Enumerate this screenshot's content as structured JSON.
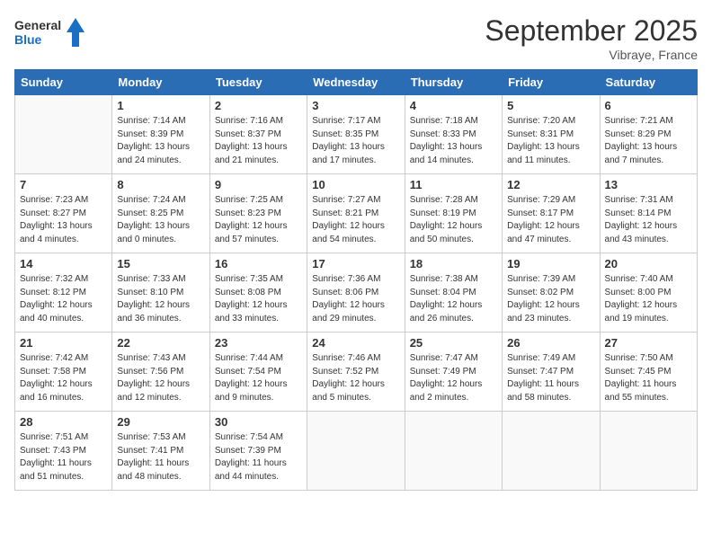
{
  "logo": {
    "general": "General",
    "blue": "Blue"
  },
  "title": "September 2025",
  "location": "Vibraye, France",
  "days_of_week": [
    "Sunday",
    "Monday",
    "Tuesday",
    "Wednesday",
    "Thursday",
    "Friday",
    "Saturday"
  ],
  "weeks": [
    [
      {
        "day": "",
        "info": ""
      },
      {
        "day": "1",
        "info": "Sunrise: 7:14 AM\nSunset: 8:39 PM\nDaylight: 13 hours\nand 24 minutes."
      },
      {
        "day": "2",
        "info": "Sunrise: 7:16 AM\nSunset: 8:37 PM\nDaylight: 13 hours\nand 21 minutes."
      },
      {
        "day": "3",
        "info": "Sunrise: 7:17 AM\nSunset: 8:35 PM\nDaylight: 13 hours\nand 17 minutes."
      },
      {
        "day": "4",
        "info": "Sunrise: 7:18 AM\nSunset: 8:33 PM\nDaylight: 13 hours\nand 14 minutes."
      },
      {
        "day": "5",
        "info": "Sunrise: 7:20 AM\nSunset: 8:31 PM\nDaylight: 13 hours\nand 11 minutes."
      },
      {
        "day": "6",
        "info": "Sunrise: 7:21 AM\nSunset: 8:29 PM\nDaylight: 13 hours\nand 7 minutes."
      }
    ],
    [
      {
        "day": "7",
        "info": "Sunrise: 7:23 AM\nSunset: 8:27 PM\nDaylight: 13 hours\nand 4 minutes."
      },
      {
        "day": "8",
        "info": "Sunrise: 7:24 AM\nSunset: 8:25 PM\nDaylight: 13 hours\nand 0 minutes."
      },
      {
        "day": "9",
        "info": "Sunrise: 7:25 AM\nSunset: 8:23 PM\nDaylight: 12 hours\nand 57 minutes."
      },
      {
        "day": "10",
        "info": "Sunrise: 7:27 AM\nSunset: 8:21 PM\nDaylight: 12 hours\nand 54 minutes."
      },
      {
        "day": "11",
        "info": "Sunrise: 7:28 AM\nSunset: 8:19 PM\nDaylight: 12 hours\nand 50 minutes."
      },
      {
        "day": "12",
        "info": "Sunrise: 7:29 AM\nSunset: 8:17 PM\nDaylight: 12 hours\nand 47 minutes."
      },
      {
        "day": "13",
        "info": "Sunrise: 7:31 AM\nSunset: 8:14 PM\nDaylight: 12 hours\nand 43 minutes."
      }
    ],
    [
      {
        "day": "14",
        "info": "Sunrise: 7:32 AM\nSunset: 8:12 PM\nDaylight: 12 hours\nand 40 minutes."
      },
      {
        "day": "15",
        "info": "Sunrise: 7:33 AM\nSunset: 8:10 PM\nDaylight: 12 hours\nand 36 minutes."
      },
      {
        "day": "16",
        "info": "Sunrise: 7:35 AM\nSunset: 8:08 PM\nDaylight: 12 hours\nand 33 minutes."
      },
      {
        "day": "17",
        "info": "Sunrise: 7:36 AM\nSunset: 8:06 PM\nDaylight: 12 hours\nand 29 minutes."
      },
      {
        "day": "18",
        "info": "Sunrise: 7:38 AM\nSunset: 8:04 PM\nDaylight: 12 hours\nand 26 minutes."
      },
      {
        "day": "19",
        "info": "Sunrise: 7:39 AM\nSunset: 8:02 PM\nDaylight: 12 hours\nand 23 minutes."
      },
      {
        "day": "20",
        "info": "Sunrise: 7:40 AM\nSunset: 8:00 PM\nDaylight: 12 hours\nand 19 minutes."
      }
    ],
    [
      {
        "day": "21",
        "info": "Sunrise: 7:42 AM\nSunset: 7:58 PM\nDaylight: 12 hours\nand 16 minutes."
      },
      {
        "day": "22",
        "info": "Sunrise: 7:43 AM\nSunset: 7:56 PM\nDaylight: 12 hours\nand 12 minutes."
      },
      {
        "day": "23",
        "info": "Sunrise: 7:44 AM\nSunset: 7:54 PM\nDaylight: 12 hours\nand 9 minutes."
      },
      {
        "day": "24",
        "info": "Sunrise: 7:46 AM\nSunset: 7:52 PM\nDaylight: 12 hours\nand 5 minutes."
      },
      {
        "day": "25",
        "info": "Sunrise: 7:47 AM\nSunset: 7:49 PM\nDaylight: 12 hours\nand 2 minutes."
      },
      {
        "day": "26",
        "info": "Sunrise: 7:49 AM\nSunset: 7:47 PM\nDaylight: 11 hours\nand 58 minutes."
      },
      {
        "day": "27",
        "info": "Sunrise: 7:50 AM\nSunset: 7:45 PM\nDaylight: 11 hours\nand 55 minutes."
      }
    ],
    [
      {
        "day": "28",
        "info": "Sunrise: 7:51 AM\nSunset: 7:43 PM\nDaylight: 11 hours\nand 51 minutes."
      },
      {
        "day": "29",
        "info": "Sunrise: 7:53 AM\nSunset: 7:41 PM\nDaylight: 11 hours\nand 48 minutes."
      },
      {
        "day": "30",
        "info": "Sunrise: 7:54 AM\nSunset: 7:39 PM\nDaylight: 11 hours\nand 44 minutes."
      },
      {
        "day": "",
        "info": ""
      },
      {
        "day": "",
        "info": ""
      },
      {
        "day": "",
        "info": ""
      },
      {
        "day": "",
        "info": ""
      }
    ]
  ]
}
